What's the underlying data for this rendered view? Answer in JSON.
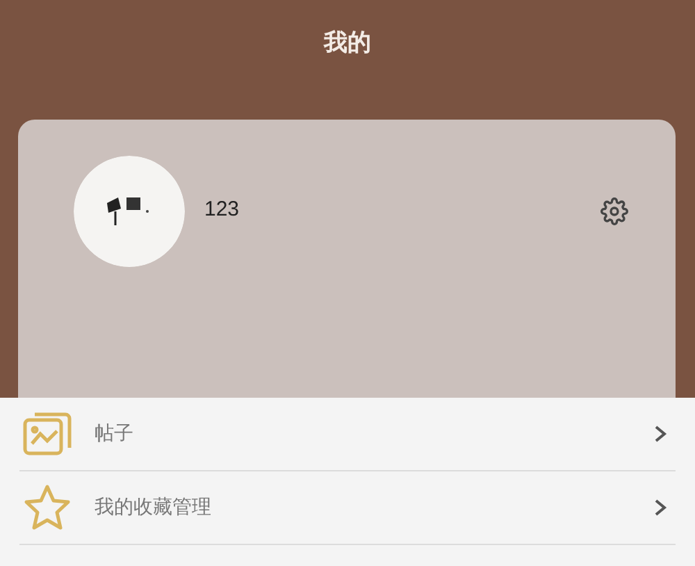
{
  "header": {
    "title": "我的"
  },
  "profile": {
    "username": "123"
  },
  "menu": [
    {
      "kind": "posts",
      "label": "帖子"
    },
    {
      "kind": "favorites",
      "label": "我的收藏管理"
    }
  ]
}
